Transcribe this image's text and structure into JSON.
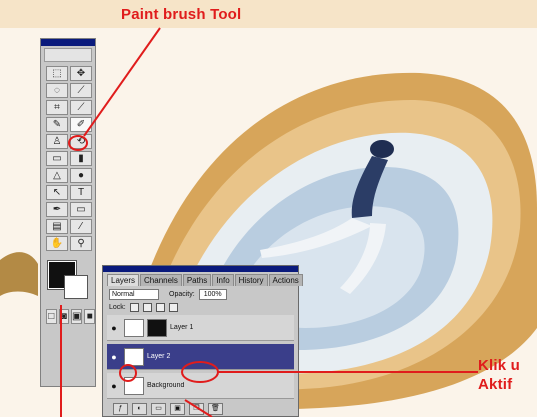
{
  "captions": {
    "paint_brush": "Paint brush Tool",
    "right_line1": "Klik u",
    "right_line2": "Aktif"
  },
  "colors": {
    "caption": "#e01c1c",
    "header_band": "#f6e4c8",
    "titlebar": "#0a1a7c",
    "foreground_swatch": "#111111",
    "background_swatch": "#ffffff"
  },
  "toolbox": {
    "tools": [
      {
        "name": "marquee-icon",
        "glyph": "⬚"
      },
      {
        "name": "move-icon",
        "glyph": "✥"
      },
      {
        "name": "lasso-icon",
        "glyph": "◌"
      },
      {
        "name": "magic-wand-icon",
        "glyph": "⟋"
      },
      {
        "name": "crop-icon",
        "glyph": "⌗"
      },
      {
        "name": "slice-icon",
        "glyph": "⟋"
      },
      {
        "name": "healing-icon",
        "glyph": "✎"
      },
      {
        "name": "paint-brush-icon",
        "glyph": "✐"
      },
      {
        "name": "clone-stamp-icon",
        "glyph": "♙"
      },
      {
        "name": "history-brush-icon",
        "glyph": "⟲"
      },
      {
        "name": "eraser-icon",
        "glyph": "▭"
      },
      {
        "name": "gradient-icon",
        "glyph": "▮"
      },
      {
        "name": "blur-icon",
        "glyph": "△"
      },
      {
        "name": "dodge-icon",
        "glyph": "●"
      },
      {
        "name": "path-select-icon",
        "glyph": "↖"
      },
      {
        "name": "type-icon",
        "glyph": "T"
      },
      {
        "name": "pen-icon",
        "glyph": "✒"
      },
      {
        "name": "shape-icon",
        "glyph": "▭"
      },
      {
        "name": "notes-icon",
        "glyph": "▤"
      },
      {
        "name": "eyedropper-icon",
        "glyph": "⁄"
      },
      {
        "name": "hand-icon",
        "glyph": "✋"
      },
      {
        "name": "zoom-icon",
        "glyph": "⚲"
      }
    ],
    "modes": [
      {
        "name": "standard-mode-icon",
        "glyph": "□"
      },
      {
        "name": "quick-mask-icon",
        "glyph": "◙"
      },
      {
        "name": "screen-mode-icon",
        "glyph": "▣"
      },
      {
        "name": "full-screen-icon",
        "glyph": "■"
      }
    ]
  },
  "layers_palette": {
    "tabs": [
      "Layers",
      "Channels",
      "Paths",
      "Info",
      "History",
      "Actions"
    ],
    "active_tab": "Layers",
    "blend_mode": "Normal",
    "opacity_label": "Opacity:",
    "opacity": "100%",
    "lock_label": "Lock:",
    "layers": [
      {
        "name": "Layer 1",
        "active": false,
        "mask": true
      },
      {
        "name": "Layer 2",
        "active": true,
        "mask": false
      },
      {
        "name": "Background",
        "active": false,
        "mask": false
      }
    ],
    "bottom_buttons": [
      "ƒ",
      "◐",
      "▭",
      "▣",
      "❐",
      "🗑"
    ]
  }
}
